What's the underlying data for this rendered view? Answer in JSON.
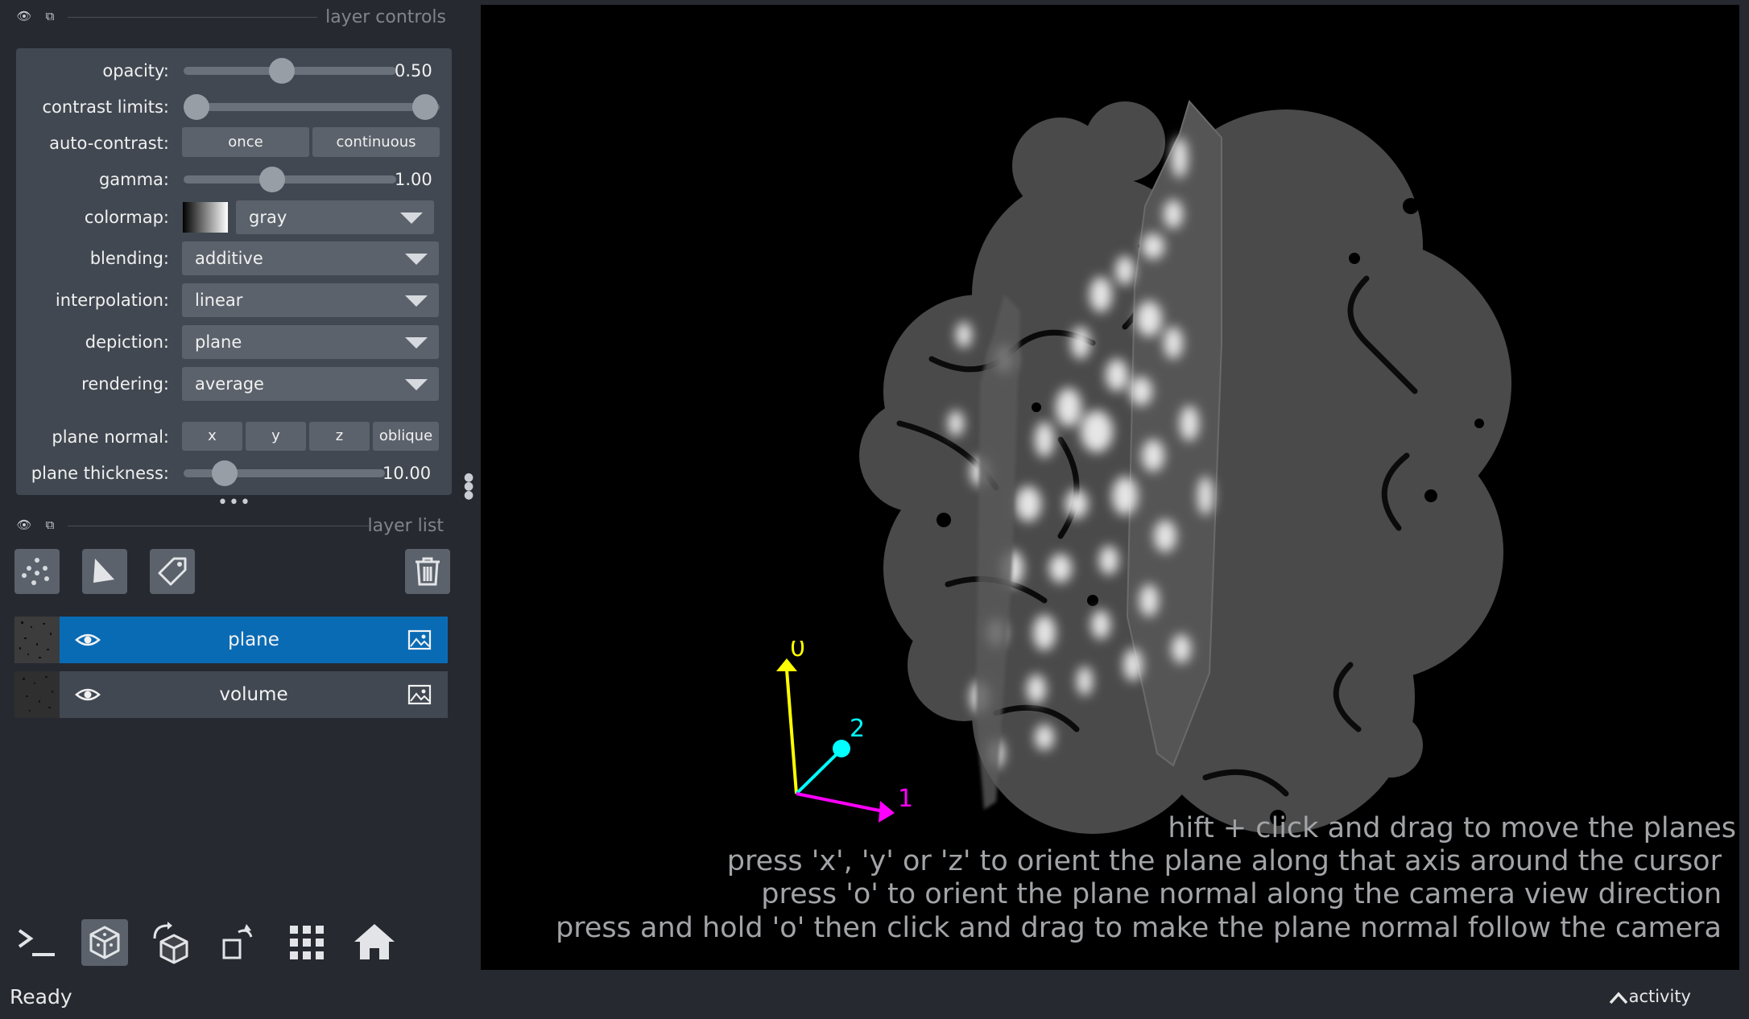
{
  "layer_controls": {
    "title": "layer controls",
    "opacity": {
      "label": "opacity:",
      "value": "0.50",
      "level": 0.5
    },
    "contrast": {
      "label": "contrast limits:",
      "low": 0,
      "high": 1
    },
    "auto_contrast": {
      "label": "auto-contrast:",
      "once": "once",
      "continuous": "continuous"
    },
    "gamma": {
      "label": "gamma:",
      "value": "1.00",
      "level": 0.45
    },
    "colormap": {
      "label": "colormap:",
      "value": "gray"
    },
    "blending": {
      "label": "blending:",
      "value": "additive"
    },
    "interpolation": {
      "label": "interpolation:",
      "value": "linear"
    },
    "depiction": {
      "label": "depiction:",
      "value": "plane"
    },
    "rendering": {
      "label": "rendering:",
      "value": "average"
    },
    "plane_normal": {
      "label": "plane normal:",
      "x": "x",
      "y": "y",
      "z": "z",
      "oblique": "oblique"
    },
    "plane_thickness": {
      "label": "plane thickness:",
      "value": "10.00",
      "level": 0.1
    }
  },
  "layer_list": {
    "title": "layer list",
    "layers": [
      {
        "name": "plane",
        "selected": true,
        "visible": true
      },
      {
        "name": "volume",
        "selected": false,
        "visible": true
      }
    ]
  },
  "canvas": {
    "axes": {
      "a0": "0",
      "a1": "1",
      "a2": "2"
    },
    "axis_colors": {
      "a0": "#ffff00",
      "a1": "#ff00ff",
      "a2": "#00ffff"
    },
    "hints": [
      "hift + click and drag to move the planes",
      "press 'x', 'y' or 'z' to orient the plane along that axis around the cursor",
      "press 'o' to orient the plane normal along the camera view direction",
      "press and hold 'o' then click and drag to make the plane normal follow the camera"
    ]
  },
  "status": {
    "text": "Ready",
    "activity": "activity"
  },
  "colors": {
    "selected_layer": "#0a6bb5",
    "panel": "#414851",
    "background": "#262930"
  }
}
